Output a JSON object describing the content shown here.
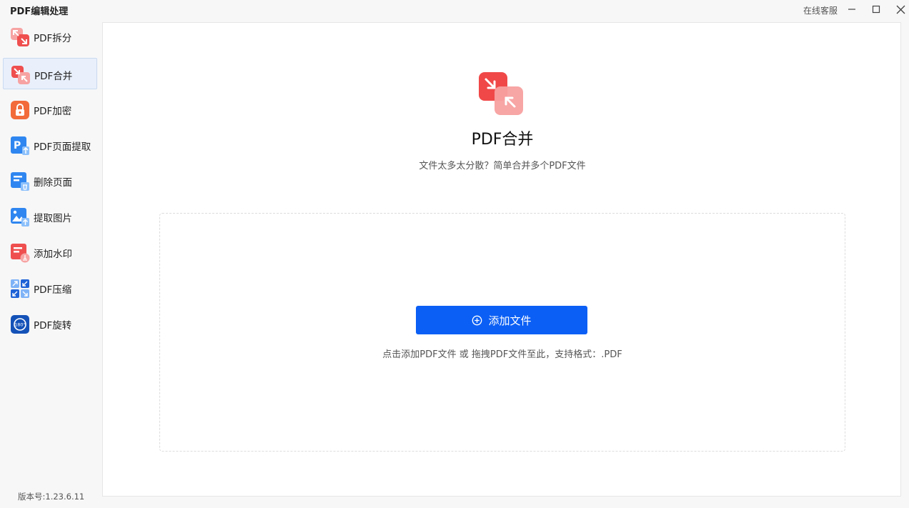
{
  "window": {
    "title": "PDF编辑处理",
    "online_service": "在线客服"
  },
  "sidebar": {
    "items": [
      {
        "label": "PDF拆分",
        "icon": "split-arrows-icon",
        "active": false
      },
      {
        "label": "PDF合并",
        "icon": "merge-arrows-icon",
        "active": true
      },
      {
        "label": "PDF加密",
        "icon": "lock-icon",
        "active": false
      },
      {
        "label": "PDF页面提取",
        "icon": "page-extract-icon",
        "active": false
      },
      {
        "label": "删除页面",
        "icon": "delete-page-icon",
        "active": false
      },
      {
        "label": "提取图片",
        "icon": "extract-image-icon",
        "active": false
      },
      {
        "label": "添加水印",
        "icon": "watermark-icon",
        "active": false
      },
      {
        "label": "PDF压缩",
        "icon": "compress-icon",
        "active": false
      },
      {
        "label": "PDF旋转",
        "icon": "rotate-180-icon",
        "active": false
      }
    ],
    "version": "版本号:1.23.6.11"
  },
  "main": {
    "title": "PDF合并",
    "subtitle": "文件太多太分散？简单合并多个PDF文件",
    "add_button_label": "添加文件",
    "hint": "点击添加PDF文件 或 拖拽PDF文件至此，支持格式：.PDF"
  },
  "colors": {
    "accent": "#0b5ff5",
    "merge_red": "#f25a5a",
    "active_bg": "#e9f0fb"
  },
  "icons": {
    "rotate_text": "180°"
  }
}
